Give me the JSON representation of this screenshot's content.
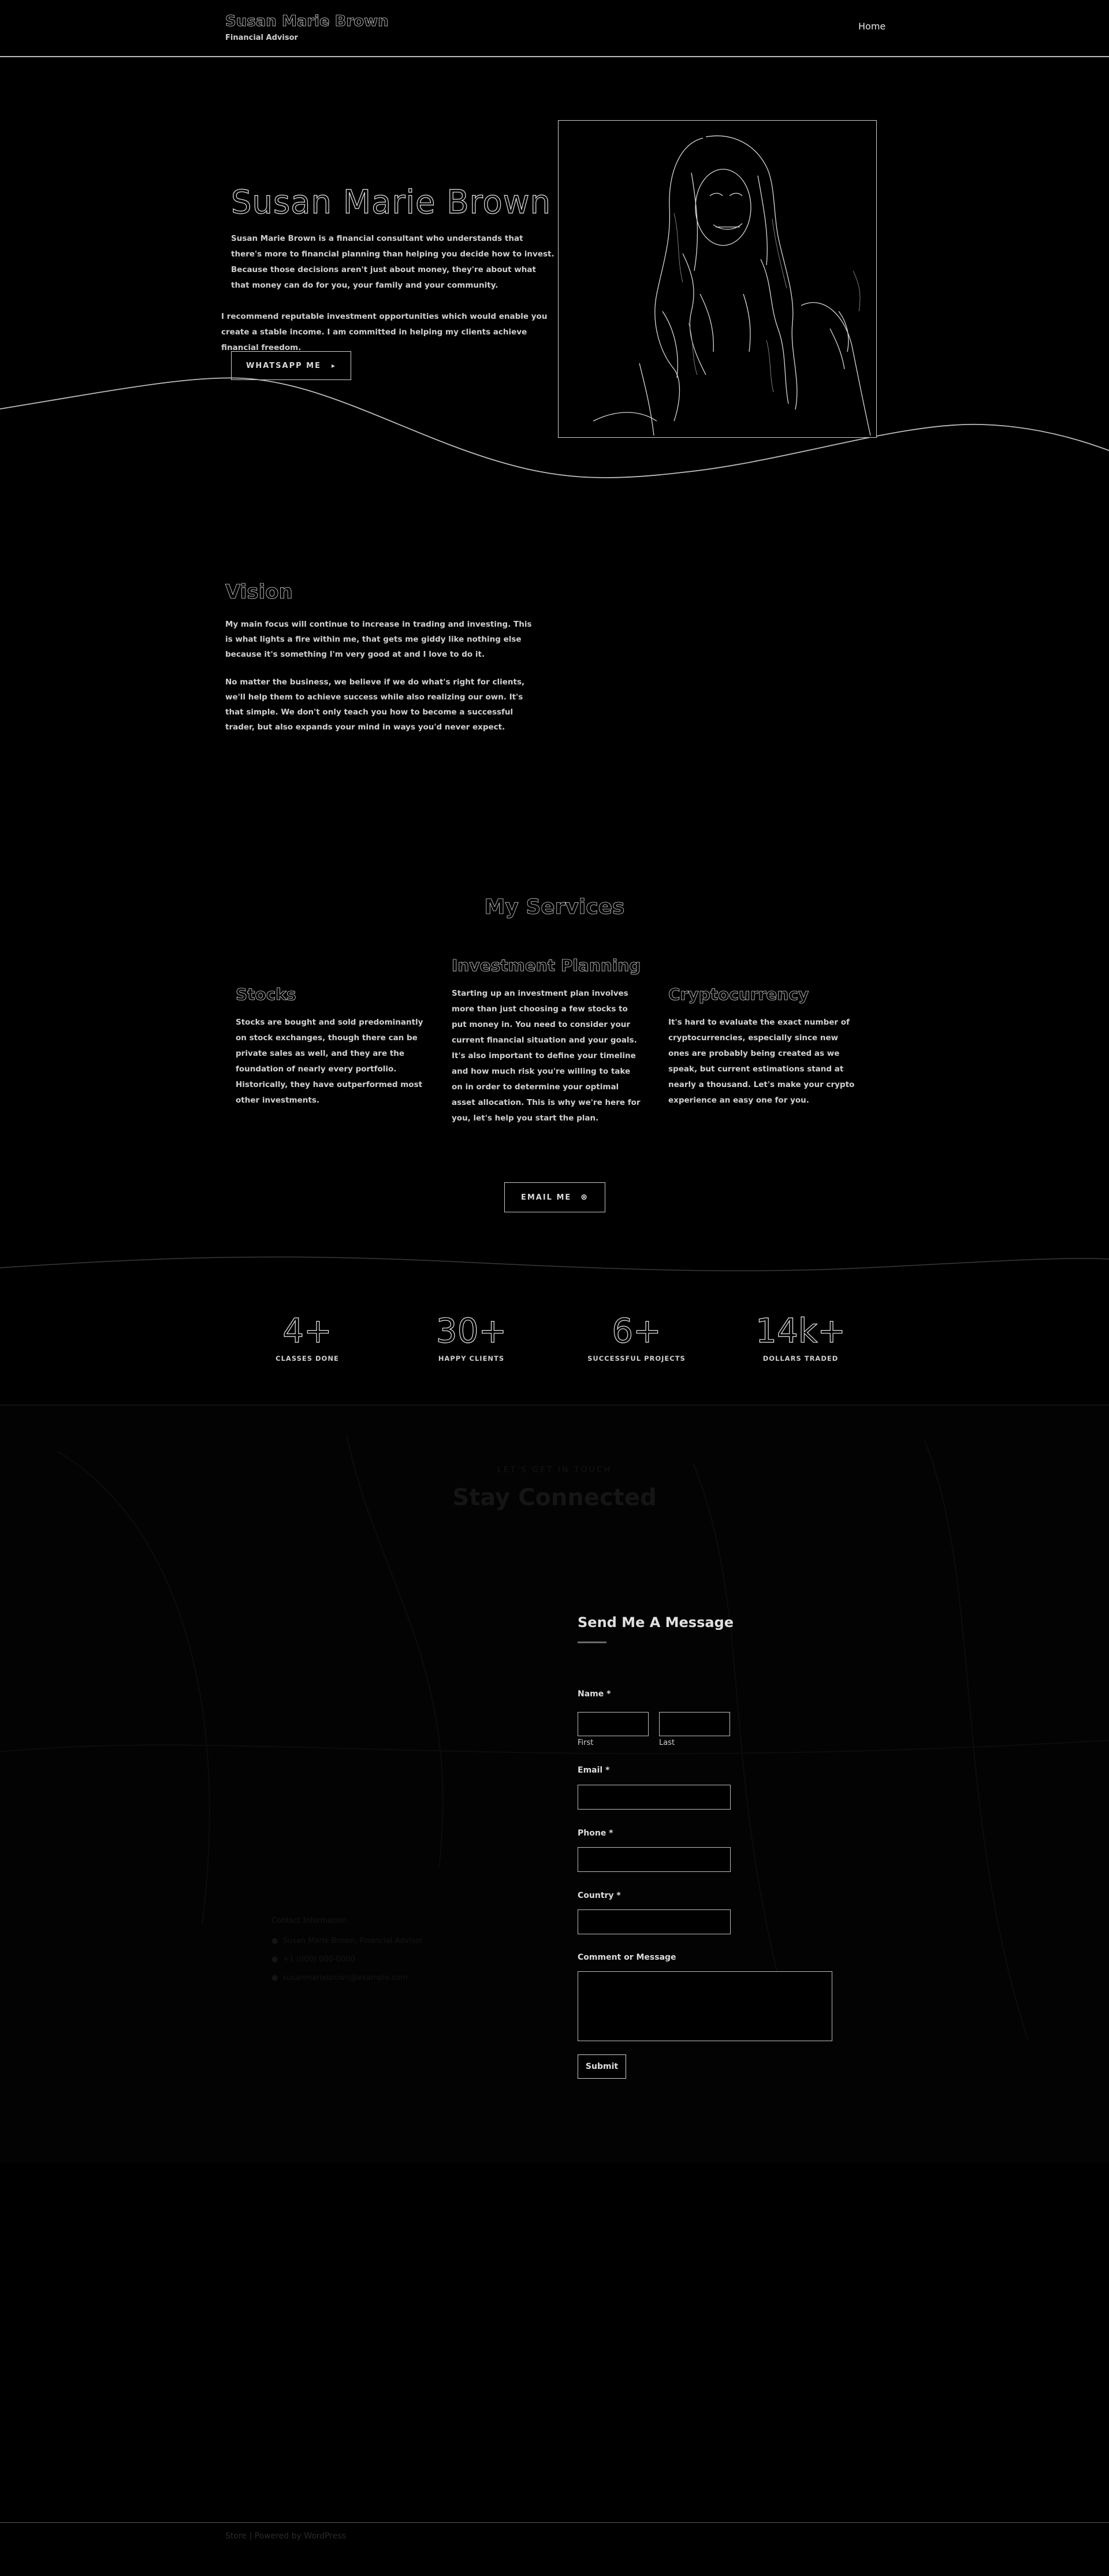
{
  "header": {
    "site_title": "Susan Marie Brown",
    "tagline": "Financial Advisor",
    "nav": [
      {
        "label": "Home"
      }
    ]
  },
  "hero": {
    "name": "Susan Marie Brown",
    "paragraph_1": "Susan Marie Brown is a financial consultant who understands that there's more to financial planning than helping you decide how to invest. Because those decisions aren't just about money, they're about what that money can do for you, your family and your community.",
    "paragraph_2": "I recommend reputable investment opportunities which would enable you create a stable income. I am committed in helping my clients achieve financial freedom.",
    "whatsapp_label": "WHATSAPP ME"
  },
  "vision": {
    "title": "Vision",
    "paragraph_1": "My main focus will continue to increase in trading and investing. This is what lights a fire within me, that gets me giddy like nothing else because it's something I'm very good at and I love to do it.",
    "paragraph_2": "No matter the business, we believe if we do what's right for clients, we'll help them to achieve success while also realizing our own. It's that simple. We don't only teach you how to become a successful trader, but also expands your mind in ways you'd never expect."
  },
  "services": {
    "title": "My Services",
    "items": [
      {
        "title": "Stocks",
        "text": "Stocks are bought and sold predominantly on stock exchanges, though there can be private sales as well, and they are the foundation of nearly every portfolio. Historically, they have outperformed most other investments."
      },
      {
        "title": "Investment Planning",
        "text": "Starting up an investment plan involves more than just choosing a few stocks to put money in. You need to consider your current financial situation and your goals. It's also important to define your timeline and how much risk you're willing to take on in order to determine your optimal asset allocation. This is why we're here for you, let's help you start the plan."
      },
      {
        "title": "Cryptocurrency",
        "text": "It's hard to evaluate the exact number of cryptocurrencies, especially since new ones are probably being created as we speak, but current estimations stand at nearly a thousand. Let's make your crypto experience an easy one for you."
      }
    ],
    "email_label": "EMAIL ME"
  },
  "stats": [
    {
      "value": "4+",
      "label": "CLASSES DONE"
    },
    {
      "value": "30+",
      "label": "HAPPY CLIENTS"
    },
    {
      "value": "6+",
      "label": "SUCCESSFUL PROJECTS"
    },
    {
      "value": "14k+",
      "label": "DOLLARS TRADED"
    }
  ],
  "contact": {
    "kicker": "LET'S GET IN TOUCH",
    "title": "Stay Connected",
    "info_title": "Contact Information",
    "info_items": [
      "Susan Marie Brown, Financial Advisor",
      "+1 (000) 000-0000",
      "susanmariebrown@example.com"
    ],
    "form": {
      "title": "Send Me A Message",
      "name_label": "Name *",
      "first_label": "First",
      "last_label": "Last",
      "email_label": "Email *",
      "phone_label": "Phone *",
      "country_label": "Country *",
      "comment_label": "Comment or Message",
      "submit_label": "Submit"
    }
  },
  "footer": {
    "text": "Store | Powered by WordPress"
  }
}
